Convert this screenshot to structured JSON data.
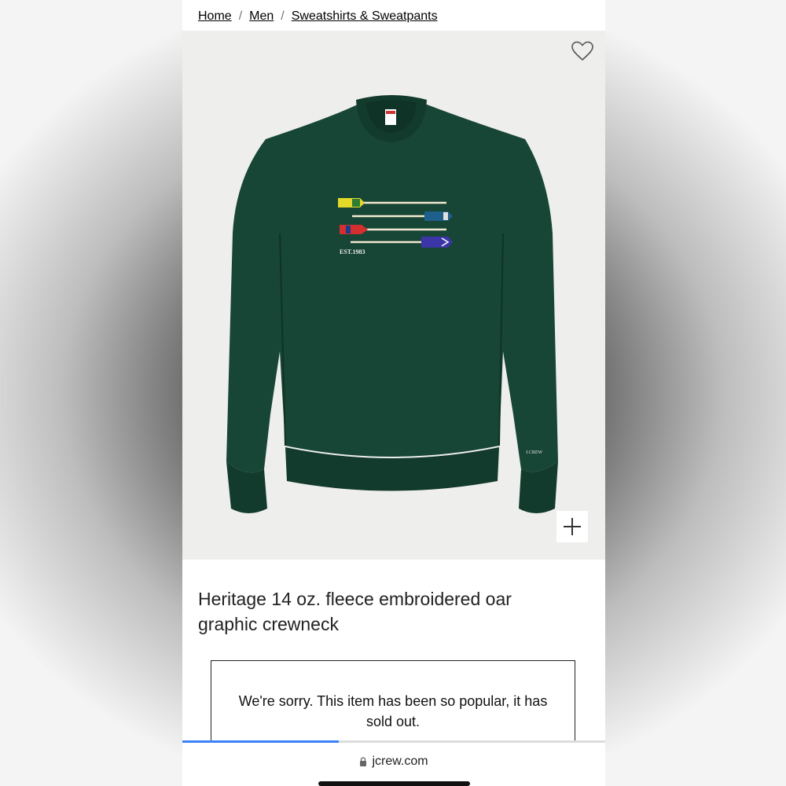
{
  "breadcrumb": [
    {
      "label": "Home"
    },
    {
      "label": "Men"
    },
    {
      "label": "Sweatshirts & Sweatpants"
    }
  ],
  "breadcrumb_separator": "/",
  "product": {
    "title": "Heritage 14 oz. fleece embroidered oar graphic crewneck",
    "embroidery_text": "EST.1983",
    "cuff_logo": "J.CREW"
  },
  "notice": {
    "message": "We're sorry. This item has been so popular, it has sold out."
  },
  "browser": {
    "url": "jcrew.com",
    "load_progress": 0.37
  },
  "icons": {
    "favorite": "heart-outline-icon",
    "zoom": "plus-icon",
    "secure": "lock-icon"
  },
  "colors": {
    "sweater": "#174536",
    "photo_bg": "#eeeeec",
    "progress": "#3b82f6"
  }
}
